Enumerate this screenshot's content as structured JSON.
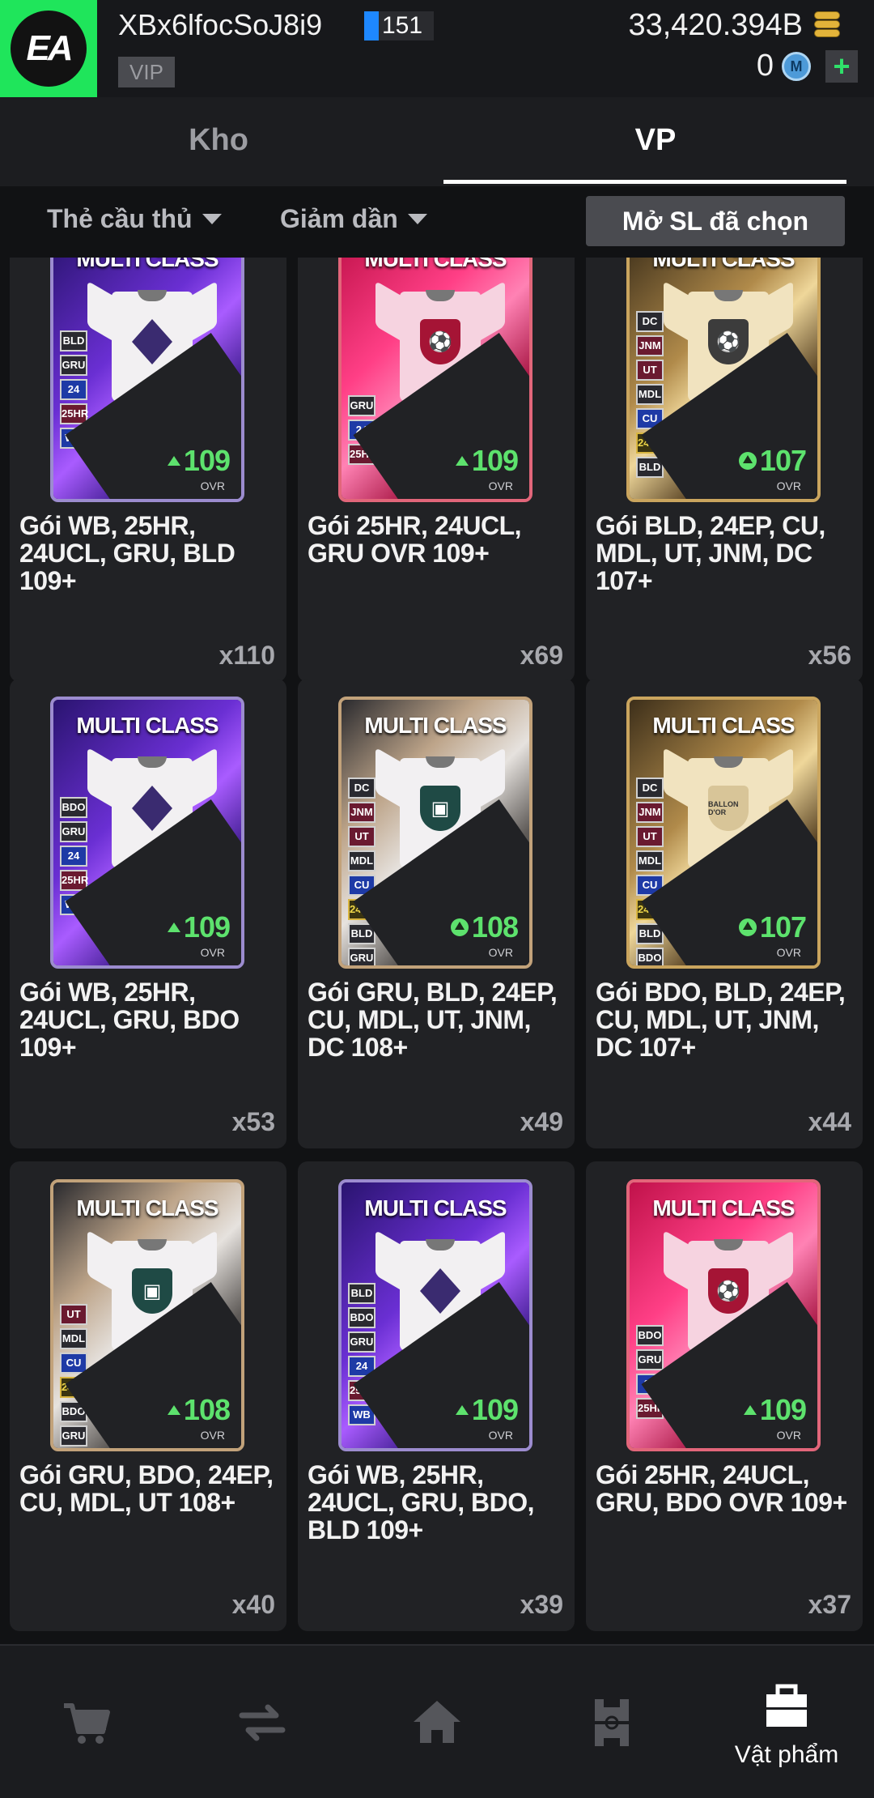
{
  "header": {
    "username": "XBx6lfocSoJ8i9",
    "level": "151",
    "vip": "VIP",
    "coins": "33,420.394B",
    "m_count": "0",
    "m_icon_label": "M",
    "plus_label": "+",
    "logo_text": "EA"
  },
  "tabs": [
    {
      "label": "Kho",
      "active": false
    },
    {
      "label": "VP",
      "active": true
    }
  ],
  "filters": {
    "type": "Thẻ cầu thủ",
    "sort": "Giảm dần",
    "open_selected": "Mở SL đã chọn"
  },
  "items": [
    {
      "name": "Gói WB, 25HR, 24UCL, GRU, BLD 109+",
      "qty": "x110",
      "pack_title": "MULTI CLASS",
      "ovr": "109",
      "ovr_label": "OVR",
      "chips": [
        "BLD",
        "GRU",
        "24",
        "25HR",
        "WB"
      ]
    },
    {
      "name": "Gói 25HR, 24UCL, GRU OVR 109+",
      "qty": "x69",
      "pack_title": "MULTI CLASS",
      "ovr": "109",
      "ovr_label": "OVR",
      "chips": [
        "GRU",
        "24",
        "25HR"
      ]
    },
    {
      "name": "Gói BLD, 24EP, CU, MDL, UT, JNM, DC 107+",
      "qty": "x56",
      "pack_title": "MULTI CLASS",
      "ovr": "107",
      "ovr_label": "OVR",
      "chips": [
        "DC",
        "JNM",
        "UT",
        "MDL",
        "CU",
        "24EP",
        "BLD"
      ]
    },
    {
      "name": "Gói WB, 25HR, 24UCL, GRU, BDO 109+",
      "qty": "x53",
      "pack_title": "MULTI CLASS",
      "ovr": "109",
      "ovr_label": "OVR",
      "chips": [
        "BDO",
        "GRU",
        "24",
        "25HR",
        "WB"
      ]
    },
    {
      "name": "Gói GRU, BLD, 24EP, CU, MDL, UT, JNM, DC 108+",
      "qty": "x49",
      "pack_title": "MULTI CLASS",
      "ovr": "108",
      "ovr_label": "OVR",
      "chips": [
        "DC",
        "JNM",
        "UT",
        "MDL",
        "CU",
        "24EP",
        "BLD",
        "GRU"
      ]
    },
    {
      "name": "Gói BDO, BLD, 24EP, CU, MDL, UT, JNM, DC 107+",
      "qty": "x44",
      "pack_title": "MULTI CLASS",
      "ovr": "107",
      "ovr_label": "OVR",
      "crest_text": "BALLON D'OR",
      "chips": [
        "DC",
        "JNM",
        "UT",
        "MDL",
        "CU",
        "24EP",
        "BLD",
        "BDO"
      ]
    },
    {
      "name": "Gói GRU, BDO, 24EP, CU, MDL, UT 108+",
      "qty": "x40",
      "pack_title": "MULTI CLASS",
      "ovr": "108",
      "ovr_label": "OVR",
      "chips": [
        "UT",
        "MDL",
        "CU",
        "24EP",
        "BDO",
        "GRU"
      ]
    },
    {
      "name": "Gói WB, 25HR, 24UCL, GRU, BDO, BLD 109+",
      "qty": "x39",
      "pack_title": "MULTI CLASS",
      "ovr": "109",
      "ovr_label": "OVR",
      "chips": [
        "BLD",
        "BDO",
        "GRU",
        "24",
        "25HR",
        "WB"
      ]
    },
    {
      "name": "Gói 25HR, 24UCL, GRU, BDO OVR 109+",
      "qty": "x37",
      "pack_title": "MULTI CLASS",
      "ovr": "109",
      "ovr_label": "OVR",
      "chips": [
        "BDO",
        "GRU",
        "24",
        "25HR"
      ]
    }
  ],
  "bottom_nav": [
    {
      "icon": "cart-icon",
      "label": ""
    },
    {
      "icon": "transfer-icon",
      "label": ""
    },
    {
      "icon": "home-icon",
      "label": ""
    },
    {
      "icon": "field-icon",
      "label": ""
    },
    {
      "icon": "bag-icon",
      "label": "Vật phẩm",
      "active": true
    }
  ],
  "colors": {
    "accent_green": "#1fe55b",
    "ovr_green": "#5de26d",
    "level_blue": "#1e88ff"
  }
}
